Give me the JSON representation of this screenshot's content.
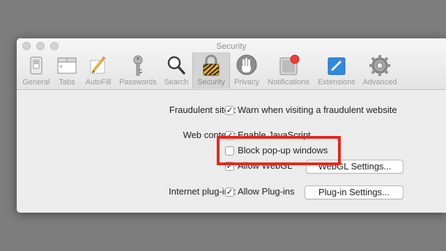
{
  "window": {
    "title": "Security"
  },
  "toolbar": {
    "items": [
      {
        "label": "General",
        "icon": "general-switch-icon"
      },
      {
        "label": "Tabs",
        "icon": "tabs-icon"
      },
      {
        "label": "AutoFill",
        "icon": "autofill-pencil-icon"
      },
      {
        "label": "Passwords",
        "icon": "key-icon"
      },
      {
        "label": "Search",
        "icon": "magnifier-icon"
      },
      {
        "label": "Security",
        "icon": "lock-icon",
        "selected": true
      },
      {
        "label": "Privacy",
        "icon": "hand-icon"
      },
      {
        "label": "Notifications",
        "icon": "notification-badge-icon"
      },
      {
        "label": "Extensions",
        "icon": "puzzle-icon"
      },
      {
        "label": "Advanced",
        "icon": "gear-icon"
      }
    ]
  },
  "settings": {
    "fraudulent": {
      "label": "Fraudulent sites:",
      "option": "Warn when visiting a fraudulent website",
      "checked": true
    },
    "web_content": {
      "label": "Web content:",
      "javascript": {
        "text": "Enable JavaScript",
        "checked": true
      },
      "popups": {
        "text": "Block pop-up windows",
        "checked": false
      },
      "webgl": {
        "text": "Allow WebGL",
        "checked": true
      },
      "webgl_button": "WebGL Settings..."
    },
    "plugins": {
      "label": "Internet plug-ins:",
      "option": "Allow Plug-ins",
      "checked": true,
      "button": "Plug-in Settings..."
    }
  },
  "highlight_color": "#e8261b"
}
